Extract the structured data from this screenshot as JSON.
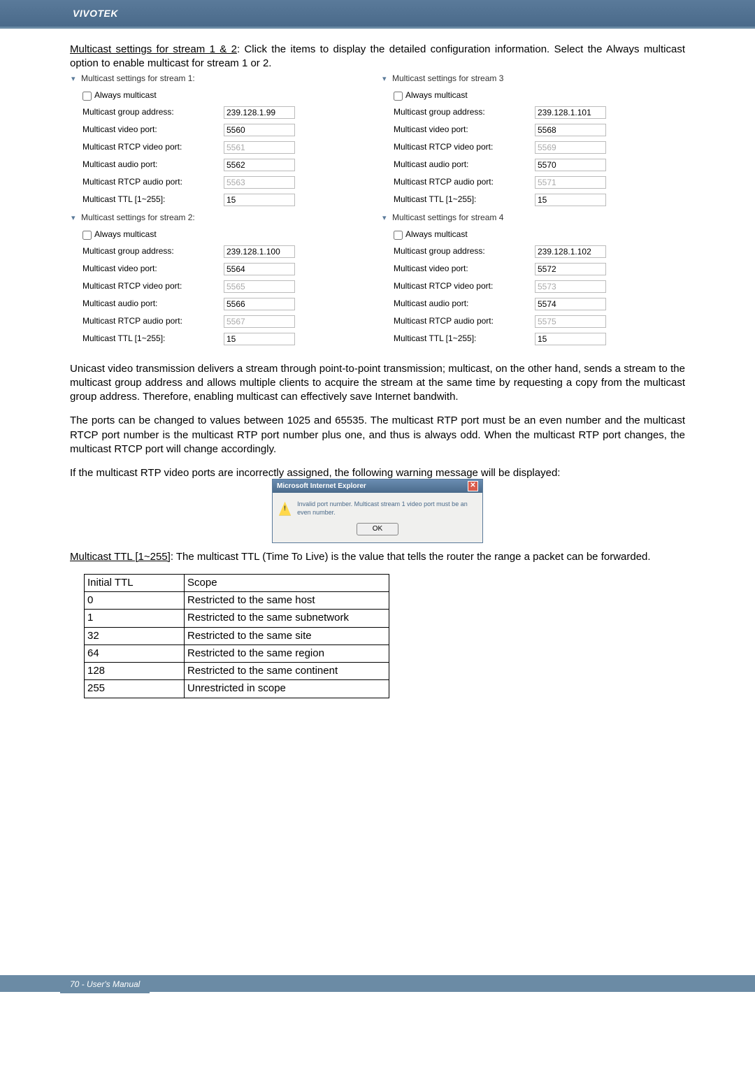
{
  "header": {
    "brand": "VIVOTEK"
  },
  "intro": {
    "title_underlined": "Multicast settings for stream 1 & 2",
    "tail": ": Click the items to display the detailed configuration information. Select the Always multicast option to enable multicast for stream 1 or 2."
  },
  "labels": {
    "always_multicast": "Always multicast",
    "group_addr": "Multicast group address:",
    "video_port": "Multicast video port:",
    "rtcp_video_port": "Multicast RTCP video port:",
    "audio_port": "Multicast audio port:",
    "rtcp_audio_port": "Multicast RTCP audio port:",
    "ttl": "Multicast TTL [1~255]:"
  },
  "streams": {
    "s1": {
      "title": "Multicast settings for stream 1:",
      "group": "239.128.1.99",
      "video": "5560",
      "rtcp_video": "5561",
      "audio": "5562",
      "rtcp_audio": "5563",
      "ttl": "15"
    },
    "s2": {
      "title": "Multicast settings for stream 2:",
      "group": "239.128.1.100",
      "video": "5564",
      "rtcp_video": "5565",
      "audio": "5566",
      "rtcp_audio": "5567",
      "ttl": "15"
    },
    "s3": {
      "title": "Multicast settings for stream 3",
      "group": "239.128.1.101",
      "video": "5568",
      "rtcp_video": "5569",
      "audio": "5570",
      "rtcp_audio": "5571",
      "ttl": "15"
    },
    "s4": {
      "title": "Multicast settings for stream 4",
      "group": "239.128.1.102",
      "video": "5572",
      "rtcp_video": "5573",
      "audio": "5574",
      "rtcp_audio": "5575",
      "ttl": "15"
    }
  },
  "body": {
    "p1": "Unicast video transmission delivers a stream through point-to-point transmission; multicast, on the other hand, sends a stream to the multicast group address and allows multiple clients to acquire the stream at the same time by requesting a copy from the multicast group address. Therefore, enabling multicast can effectively save Internet bandwith.",
    "p2": "The ports can be changed to values between 1025 and 65535. The multicast RTP port must be an even number and the multicast RTCP port number is the multicast RTP port number plus one, and thus is always odd. When the multicast RTP port changes, the multicast RTCP port will change accordingly.",
    "p3": "If the multicast RTP video ports are incorrectly assigned, the following warning message will be displayed:"
  },
  "dialog": {
    "title": "Microsoft Internet Explorer",
    "message": "Invalid port number. Multicast stream 1 video port must be an even number.",
    "ok": "OK"
  },
  "ttl_section": {
    "title_underlined": "Multicast TTL [1~255]",
    "tail": ": The multicast TTL (Time To Live) is the value that tells the router the range a packet can be forwarded."
  },
  "ttl_table": {
    "headers": [
      "Initial TTL",
      "Scope"
    ],
    "rows": [
      [
        "0",
        "Restricted to the same host"
      ],
      [
        "1",
        "Restricted to the same subnetwork"
      ],
      [
        "32",
        "Restricted to the same site"
      ],
      [
        "64",
        "Restricted to the same region"
      ],
      [
        "128",
        "Restricted to the same continent"
      ],
      [
        "255",
        "Unrestricted in scope"
      ]
    ]
  },
  "footer": {
    "page": "70 - User's Manual"
  }
}
